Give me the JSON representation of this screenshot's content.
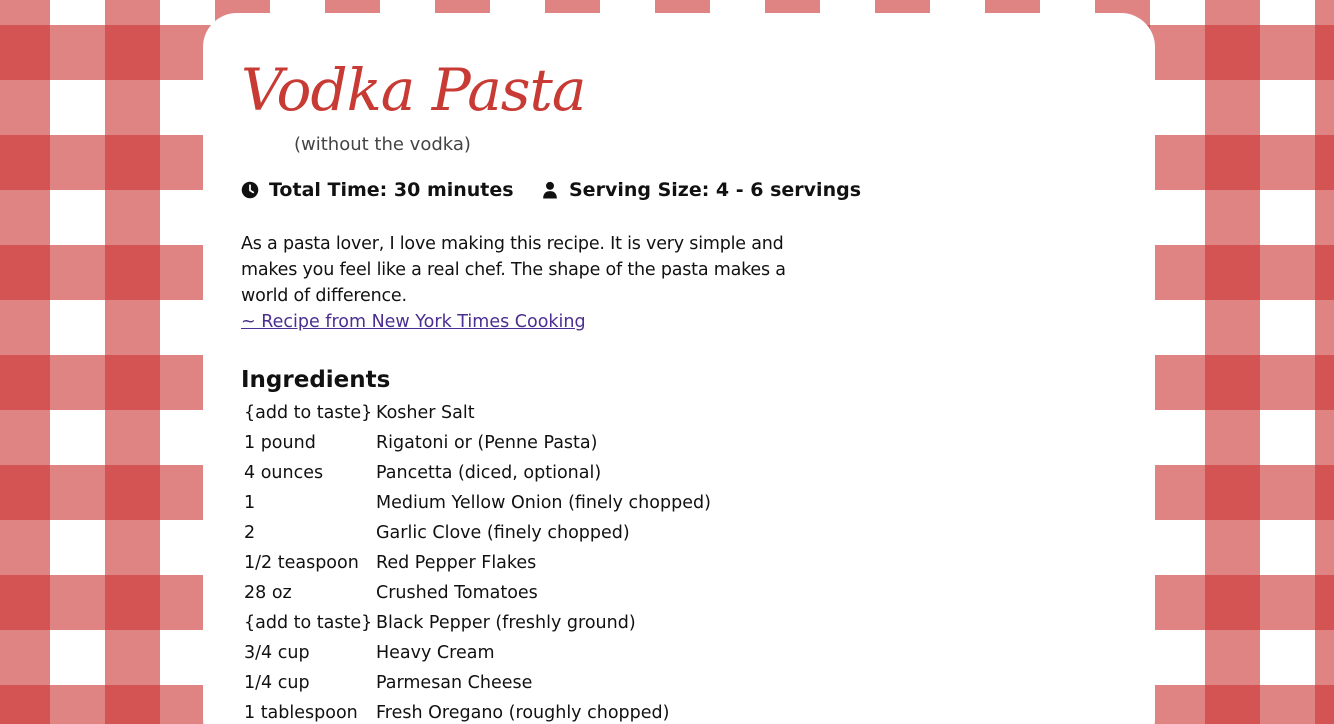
{
  "recipe": {
    "title": "Vodka Pasta",
    "subtitle": "(without the vodka)",
    "total_time": "Total Time: 30 minutes",
    "serving_size": "Serving Size: 4 - 6 servings",
    "description": "As a pasta lover, I love making this recipe. It is very simple and makes you feel like a real chef. The shape of the pasta makes a world of difference.",
    "source_link": "~ Recipe from New York Times Cooking"
  },
  "ingredients": {
    "heading": "Ingredients",
    "items": [
      {
        "qty": "{add to taste}",
        "name": "Kosher Salt"
      },
      {
        "qty": "1 pound",
        "name": "Rigatoni or (Penne Pasta)"
      },
      {
        "qty": "4 ounces",
        "name": "Pancetta (diced, optional)"
      },
      {
        "qty": "1",
        "name": "Medium Yellow Onion (finely chopped)"
      },
      {
        "qty": "2",
        "name": "Garlic Clove (finely chopped)"
      },
      {
        "qty": "1/2 teaspoon",
        "name": "Red Pepper Flakes"
      },
      {
        "qty": "28 oz",
        "name": "Crushed Tomatoes"
      },
      {
        "qty": "{add to taste}",
        "name": "Black Pepper (freshly ground)"
      },
      {
        "qty": "3/4 cup",
        "name": "Heavy Cream"
      },
      {
        "qty": "1/4 cup",
        "name": "Parmesan Cheese"
      },
      {
        "qty": "1 tablespoon",
        "name": "Fresh Oregano (roughly chopped)"
      }
    ]
  },
  "theme": {
    "accent": "#c83a34",
    "link": "#4b2e91",
    "gingham": "#cd3737"
  },
  "icons": {
    "time": "clock-icon",
    "serving": "person-icon"
  }
}
